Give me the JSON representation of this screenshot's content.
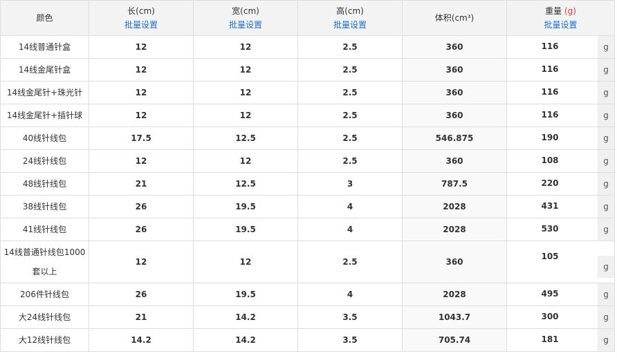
{
  "header": {
    "color": "颜色",
    "length": "长(cm)",
    "width": "宽(cm)",
    "height": "高(cm)",
    "volume": "体积(cm³)",
    "weight": "重量",
    "weight_unit": "(g)",
    "batch_label": "批量设置"
  },
  "rows": [
    {
      "color": "14线普通针盒",
      "length": "12",
      "width": "12",
      "height": "2.5",
      "volume": "360",
      "weight": "116",
      "unit": "g"
    },
    {
      "color": "14线金尾针盒",
      "length": "12",
      "width": "12",
      "height": "2.5",
      "volume": "360",
      "weight": "116",
      "unit": "g"
    },
    {
      "color": "14线金尾针+珠光针",
      "length": "12",
      "width": "12",
      "height": "2.5",
      "volume": "360",
      "weight": "116",
      "unit": "g"
    },
    {
      "color": "14线金尾针+插针球",
      "length": "12",
      "width": "12",
      "height": "2.5",
      "volume": "360",
      "weight": "116",
      "unit": "g"
    },
    {
      "color": "40线针线包",
      "length": "17.5",
      "width": "12.5",
      "height": "2.5",
      "volume": "546.875",
      "weight": "190",
      "unit": "g"
    },
    {
      "color": "24线针线包",
      "length": "12",
      "width": "12",
      "height": "2.5",
      "volume": "360",
      "weight": "108",
      "unit": "g"
    },
    {
      "color": "48线针线包",
      "length": "21",
      "width": "12.5",
      "height": "3",
      "volume": "787.5",
      "weight": "220",
      "unit": "g"
    },
    {
      "color": "38线针线包",
      "length": "26",
      "width": "19.5",
      "height": "4",
      "volume": "2028",
      "weight": "431",
      "unit": "g"
    },
    {
      "color": "41线针线包",
      "length": "26",
      "width": "19.5",
      "height": "4",
      "volume": "2028",
      "weight": "530",
      "unit": "g"
    },
    {
      "color": "14线普通针线包1000套以上",
      "length": "12",
      "width": "12",
      "height": "2.5",
      "volume": "360",
      "weight": "105",
      "unit": "g"
    },
    {
      "color": "206件针线包",
      "length": "26",
      "width": "19.5",
      "height": "4",
      "volume": "2028",
      "weight": "495",
      "unit": "g"
    },
    {
      "color": "大24线针线包",
      "length": "21",
      "width": "14.2",
      "height": "3.5",
      "volume": "1043.7",
      "weight": "300",
      "unit": "g"
    },
    {
      "color": "大12线针线包",
      "length": "14.2",
      "width": "14.2",
      "height": "3.5",
      "volume": "705.74",
      "weight": "181",
      "unit": "g"
    }
  ]
}
